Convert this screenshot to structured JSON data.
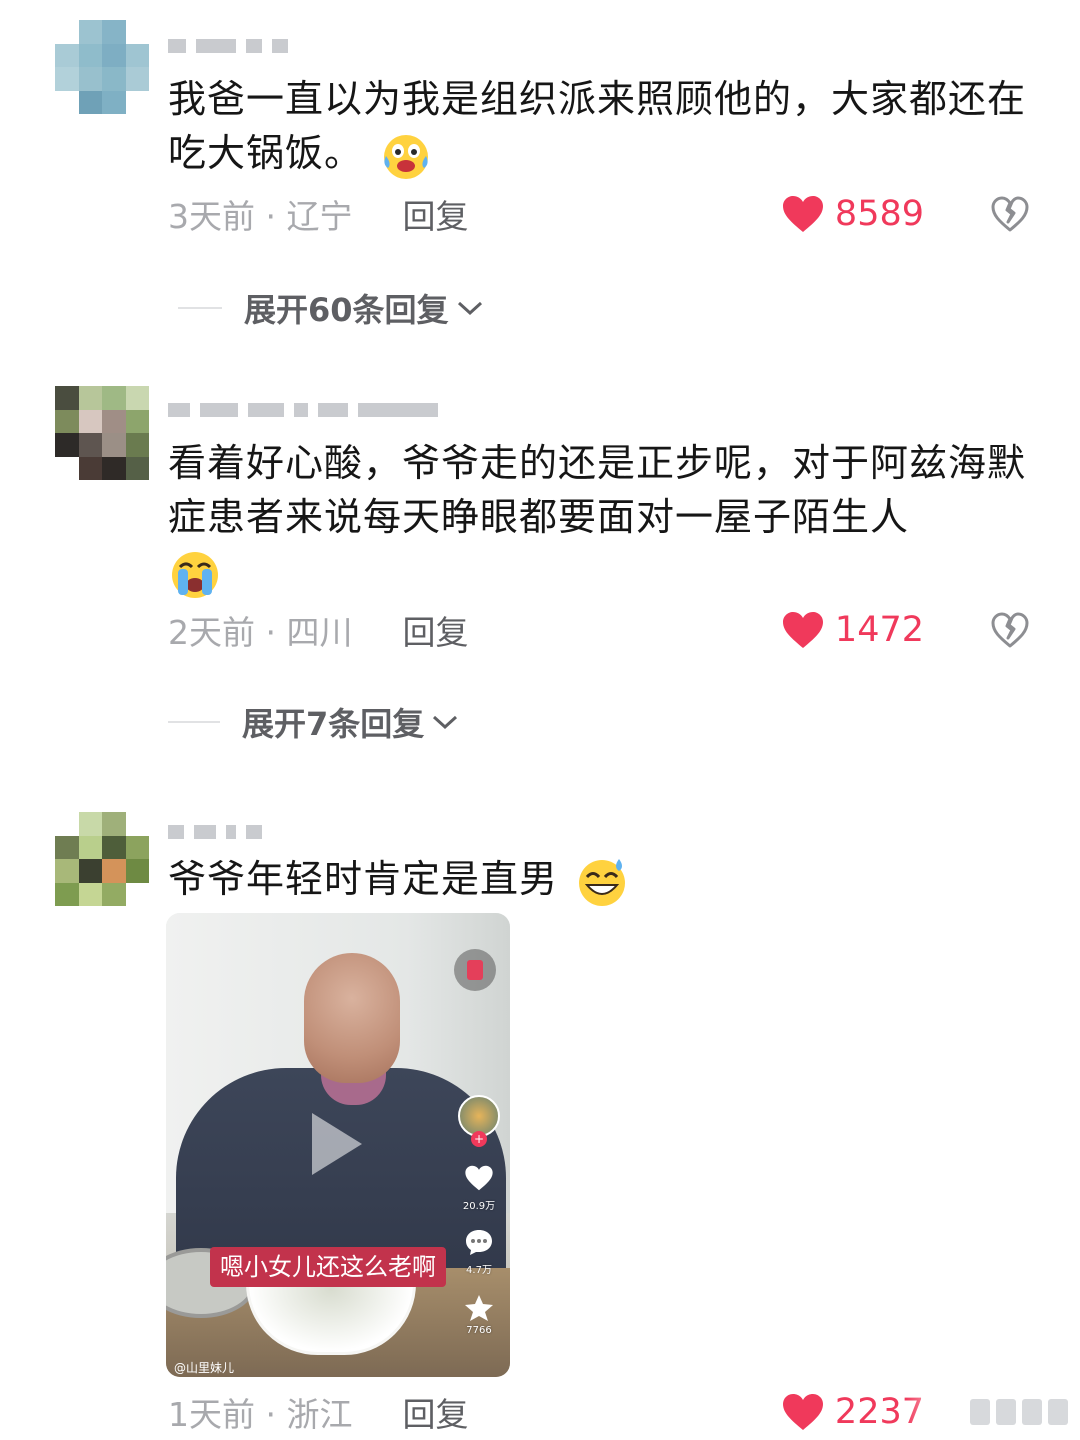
{
  "comments": [
    {
      "text": "我爸一直以为我是组织派来照顾他的，大家都还在吃大锅饭。",
      "emoji": "tears-of-joy-emoji",
      "meta": "3天前 · 辽宁",
      "reply_label": "回复",
      "likes": "8589",
      "expand_label": "展开60条回复"
    },
    {
      "text": "看着好心酸，爷爷走的还是正步呢，对于阿兹海默症患者来说每天睁眼都要面对一屋子陌生人",
      "emoji": "loudly-crying-emoji",
      "meta": "2天前 · 四川",
      "reply_label": "回复",
      "likes": "1472",
      "expand_label": "展开7条回复"
    },
    {
      "text": "爷爷年轻时肯定是直男",
      "emoji": "grinning-sweat-emoji",
      "meta": "1天前 · 浙江",
      "reply_label": "回复",
      "likes": "2237"
    }
  ],
  "video": {
    "caption": "嗯小女儿还这么老啊",
    "likes": "20.9万",
    "comments": "4.7万",
    "favorites": "7766",
    "handle": "@山里妹儿"
  },
  "colors": {
    "like": "#f0395b",
    "meta": "#a8a9ad",
    "reply": "#5e5f63"
  }
}
